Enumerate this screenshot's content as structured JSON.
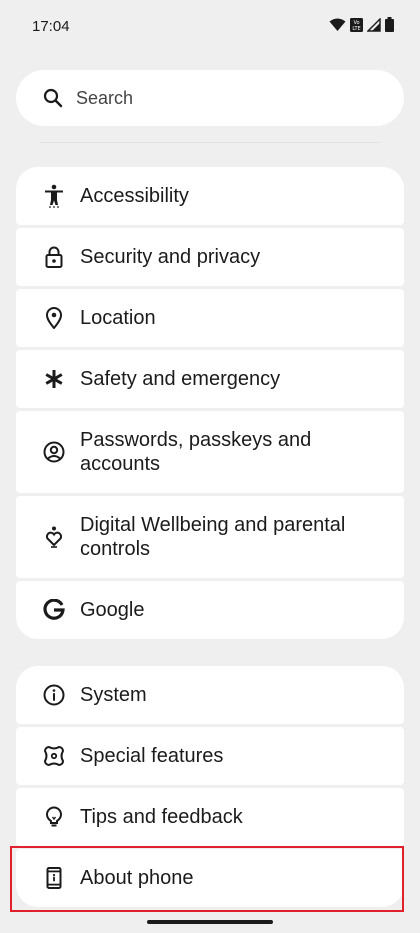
{
  "status_bar": {
    "time": "17:04",
    "icons": [
      "wifi-icon",
      "volte-icon",
      "signal-icon",
      "battery-icon"
    ]
  },
  "search": {
    "placeholder": "Search",
    "icon": "search-icon"
  },
  "groups": [
    {
      "items": [
        {
          "label": "Accessibility",
          "icon": "accessibility-icon"
        },
        {
          "label": "Security and privacy",
          "icon": "lock-icon"
        },
        {
          "label": "Location",
          "icon": "location-pin-icon"
        },
        {
          "label": "Safety and emergency",
          "icon": "asterisk-icon"
        },
        {
          "label": "Passwords, passkeys and accounts",
          "icon": "account-circle-icon"
        },
        {
          "label": "Digital Wellbeing and parental controls",
          "icon": "wellbeing-heart-icon"
        },
        {
          "label": "Google",
          "icon": "google-g-icon"
        }
      ]
    },
    {
      "items": [
        {
          "label": "System",
          "icon": "info-icon"
        },
        {
          "label": "Special features",
          "icon": "special-features-icon"
        },
        {
          "label": "Tips and feedback",
          "icon": "lightbulb-icon"
        },
        {
          "label": "About phone",
          "icon": "phone-info-icon"
        }
      ]
    }
  ],
  "colors": {
    "background": "#efefef",
    "card": "#ffffff",
    "highlight": "#e0202a"
  }
}
